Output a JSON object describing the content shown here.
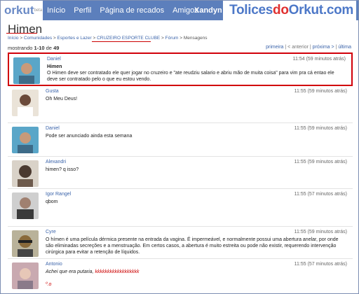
{
  "header": {
    "logo": "orkut",
    "logo_suffix": "beta",
    "nav": [
      "Início",
      "Perfil",
      "Página de recados",
      "Amigos"
    ],
    "user": "Xandyn",
    "watermark_a": "Tolices",
    "watermark_b": "do",
    "watermark_c": "Orkut",
    "watermark_d": ".com"
  },
  "page": {
    "title": "Himen",
    "breadcrumb": {
      "home": "Início",
      "communities": "Comunidades",
      "category": "Esportes e Lazer",
      "community": "CRUZEIRO ESPORTE CLUBE",
      "forum": "Fórum",
      "current": "Mensagens"
    },
    "showing_prefix": "mostrando",
    "showing_range": "1-10",
    "showing_of": "de",
    "showing_total": "49",
    "pager": {
      "first": "primeira",
      "prev": "< anterior",
      "next": "próxima >",
      "last": "última"
    }
  },
  "messages": [
    {
      "author": "Daniel",
      "time": "11:54 (59 minutos atrás)",
      "subject": "Himen",
      "text": "O Himen deve ser contratado ele quer jogar no cruzeiro e \"ate reudziu salario e abriu mão de muita coisa\" para vim pra cá entao ele deve ser contratado pelo o que eu estou vendo.",
      "avatar_color": "#5aa6c8"
    },
    {
      "author": "Gusta",
      "time": "11:55 (59 minutos atrás)",
      "text": "Oh Meu Deus!",
      "avatar_color": "#6b4a3a"
    },
    {
      "author": "Daniel",
      "time": "11:55 (59 minutos atrás)",
      "text": "Pode ser anunciado ainda esta semana",
      "avatar_color": "#5aa6c8"
    },
    {
      "author": "Alexandri",
      "time": "11:55 (59 minutos atrás)",
      "text": "himen? q isso?",
      "avatar_color": "#4b3a30"
    },
    {
      "author": "Igor Rangel",
      "time": "11:55 (57 minutos atrás)",
      "text": "qbom",
      "avatar_color": "#3a3a3a"
    },
    {
      "author": "Cyre",
      "time": "11:55 (59 minutos atrás)",
      "text": "O hímen é uma película dérmica presente na entrada da vagina. É impermeável, e normalmente possui uma abertura anelar, por onde são eliminadas secreções e a menstruação. Em certos casos, a abertura é muito estreita ou pode não existir, requerendo intervenção cirúrgica para evitar a retenção de líquidos.",
      "avatar_color": "#8a6a3a"
    },
    {
      "author": "Antonio",
      "time": "11:55 (57 minutos atrás)",
      "text": "Achei que era putaria,",
      "laugh": "kkkkkkkkkkkkkkkkkk",
      "extra": "º.o",
      "avatar_color": "#c9a9b0"
    }
  ]
}
